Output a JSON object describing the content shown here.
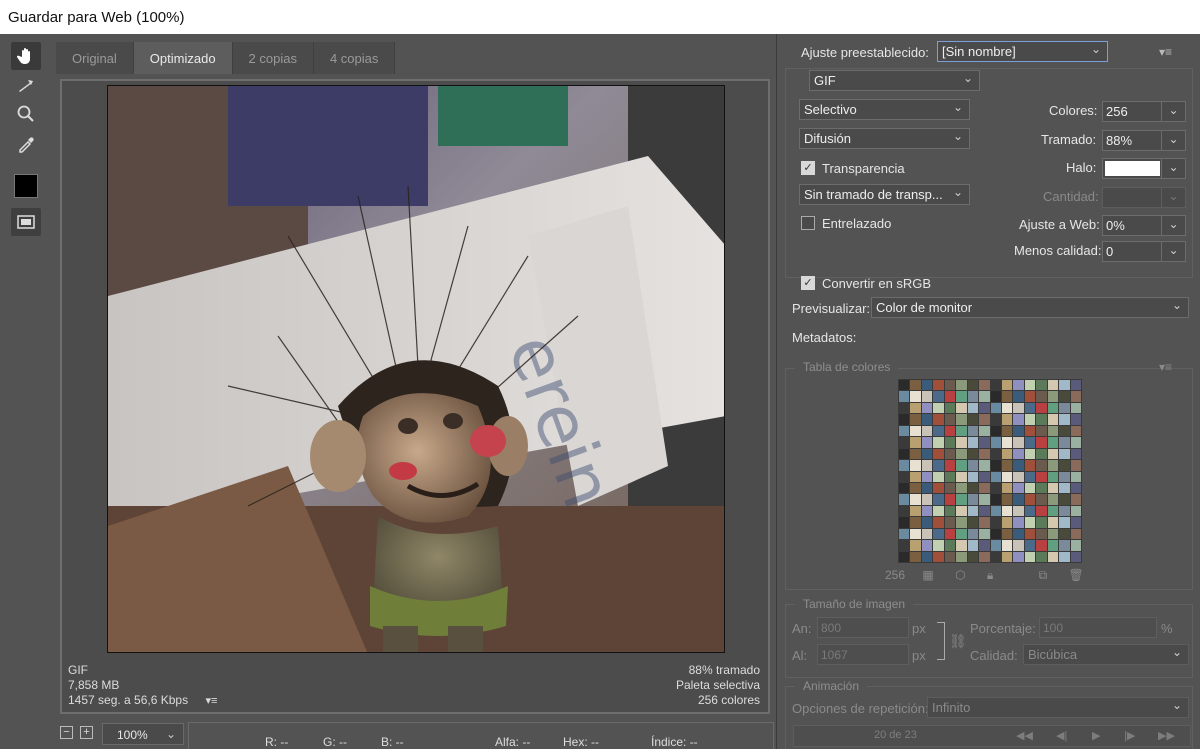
{
  "window": {
    "title": "Guardar para Web (100%)"
  },
  "tabs": [
    "Original",
    "Optimizado",
    "2 copias",
    "4 copias"
  ],
  "active_tab": 1,
  "image_info_left": {
    "format": "GIF",
    "size": "7,858 MB",
    "time": "1457 seg. a 56,6 Kbps"
  },
  "image_info_right": {
    "dither": "88% tramado",
    "palette": "Paleta selectiva",
    "colors": "256 colores"
  },
  "statusbar": {
    "zoom": "100%",
    "r": "R: --",
    "g": "G: --",
    "b": "B: --",
    "alpha": "Alfa: --",
    "hex": "Hex: --",
    "index": "Índice: --"
  },
  "settings": {
    "preset_label": "Ajuste preestablecido:",
    "preset_value": "[Sin nombre]",
    "format": "GIF",
    "reduction": "Selectivo",
    "dither_algo": "Difusión",
    "transparency_label": "Transparencia",
    "transparency_checked": true,
    "trans_dither": "Sin tramado de transp...",
    "interlaced_label": "Entrelazado",
    "interlaced_checked": false,
    "colors_label": "Colores:",
    "colors_value": "256",
    "dither_label": "Tramado:",
    "dither_value": "88%",
    "matte_label": "Halo:",
    "amount_label": "Cantidad:",
    "web_snap_label": "Ajuste a Web:",
    "web_snap_value": "0%",
    "lossy_label": "Menos calidad:",
    "lossy_value": "0",
    "srgb_label": "Convertir en sRGB",
    "srgb_checked": true,
    "preview_label": "Previsualizar:",
    "preview_value": "Color de monitor",
    "metadata_label": "Metadatos:"
  },
  "color_table": {
    "title": "Tabla de colores",
    "count": "256"
  },
  "image_size": {
    "title": "Tamaño de imagen",
    "w_label": "An:",
    "w_value": "800",
    "w_unit": "px",
    "h_label": "Al:",
    "h_value": "1067",
    "h_unit": "px",
    "pct_label": "Porcentaje:",
    "pct_value": "100",
    "pct_unit": "%",
    "quality_label": "Calidad:",
    "quality_value": "Bicúbica"
  },
  "animation": {
    "title": "Animación",
    "loop_label": "Opciones de repetición:",
    "loop_value": "Infinito",
    "frame": "20 de 23"
  },
  "colors": {
    "bg": "#535353",
    "accent": "#7d9fd6"
  }
}
